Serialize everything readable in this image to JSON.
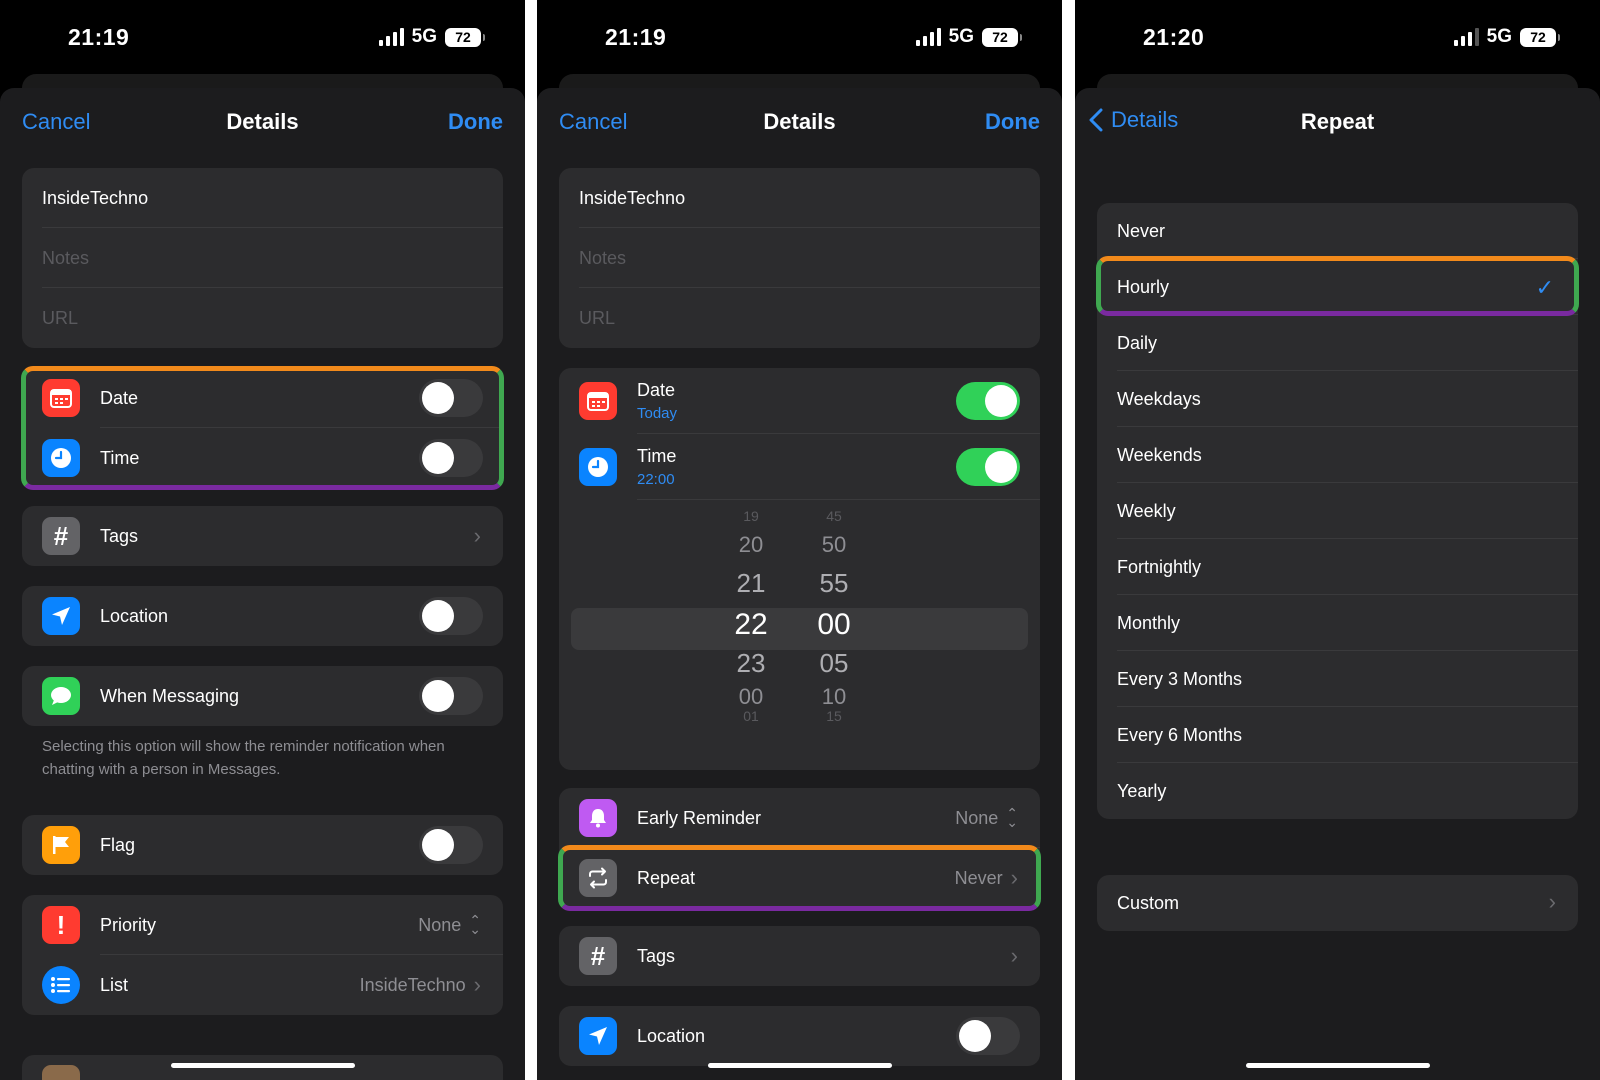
{
  "status": {
    "p1_time": "21:19",
    "p2_time": "21:19",
    "p3_time": "21:20",
    "network": "5G",
    "battery": "72"
  },
  "details": {
    "cancel": "Cancel",
    "title": "Details",
    "done": "Done",
    "name_value": "InsideTechno",
    "notes_placeholder": "Notes",
    "url_placeholder": "URL"
  },
  "rows": {
    "date": "Date",
    "date_sub": "Today",
    "time": "Time",
    "time_sub": "22:00",
    "tags": "Tags",
    "location": "Location",
    "when_messaging": "When Messaging",
    "messaging_note": "Selecting this option will show the reminder notification when chatting with a person in Messages.",
    "flag": "Flag",
    "priority": "Priority",
    "priority_value": "None",
    "list": "List",
    "list_value": "InsideTechno",
    "early_reminder": "Early Reminder",
    "early_reminder_value": "None",
    "repeat": "Repeat",
    "repeat_value": "Never"
  },
  "toggles": {
    "p1_date": false,
    "p1_time": false,
    "p1_location": false,
    "p1_when_messaging": false,
    "p1_flag": false,
    "p2_date": true,
    "p2_time": true,
    "p2_location": false
  },
  "time_picker": {
    "hours": [
      "19",
      "20",
      "21",
      "22",
      "23",
      "00",
      "01"
    ],
    "minutes": [
      "45",
      "50",
      "55",
      "00",
      "05",
      "10",
      "15"
    ],
    "selected_hour": "22",
    "selected_minute": "00"
  },
  "repeat_screen": {
    "back": "Details",
    "title": "Repeat",
    "options": [
      "Never",
      "Hourly",
      "Daily",
      "Weekdays",
      "Weekends",
      "Weekly",
      "Fortnightly",
      "Monthly",
      "Every 3 Months",
      "Every 6 Months",
      "Yearly"
    ],
    "selected": "Hourly",
    "custom": "Custom"
  },
  "colors": {
    "accent": "#2f8cf3",
    "toggle_on": "#30d158",
    "highlight_top": "#f28a1b",
    "highlight_bottom": "#7a2aa0",
    "highlight_side": "#3fa850"
  }
}
